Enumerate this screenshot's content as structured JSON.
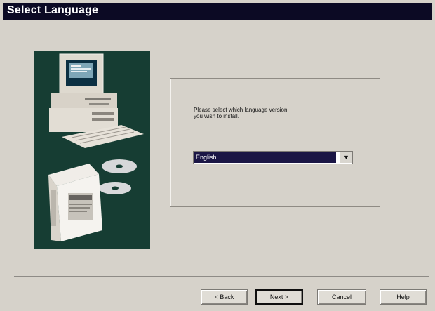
{
  "window": {
    "title": "Select Language"
  },
  "main": {
    "prompt_line1": "Please select which language version",
    "prompt_line2": "you wish to install.",
    "language_select": {
      "value": "English"
    }
  },
  "buttons": {
    "back": "< Back",
    "next": "Next >",
    "cancel": "Cancel",
    "help": "Help"
  },
  "colors": {
    "titlebar": "#0c0a24",
    "panel_bg": "#163d33",
    "dialog_bg": "#d6d2ca",
    "selection": "#1b1645"
  },
  "icons": {
    "illustration": "computer-and-software-illustration",
    "dropdown": "chevron-down-icon"
  }
}
